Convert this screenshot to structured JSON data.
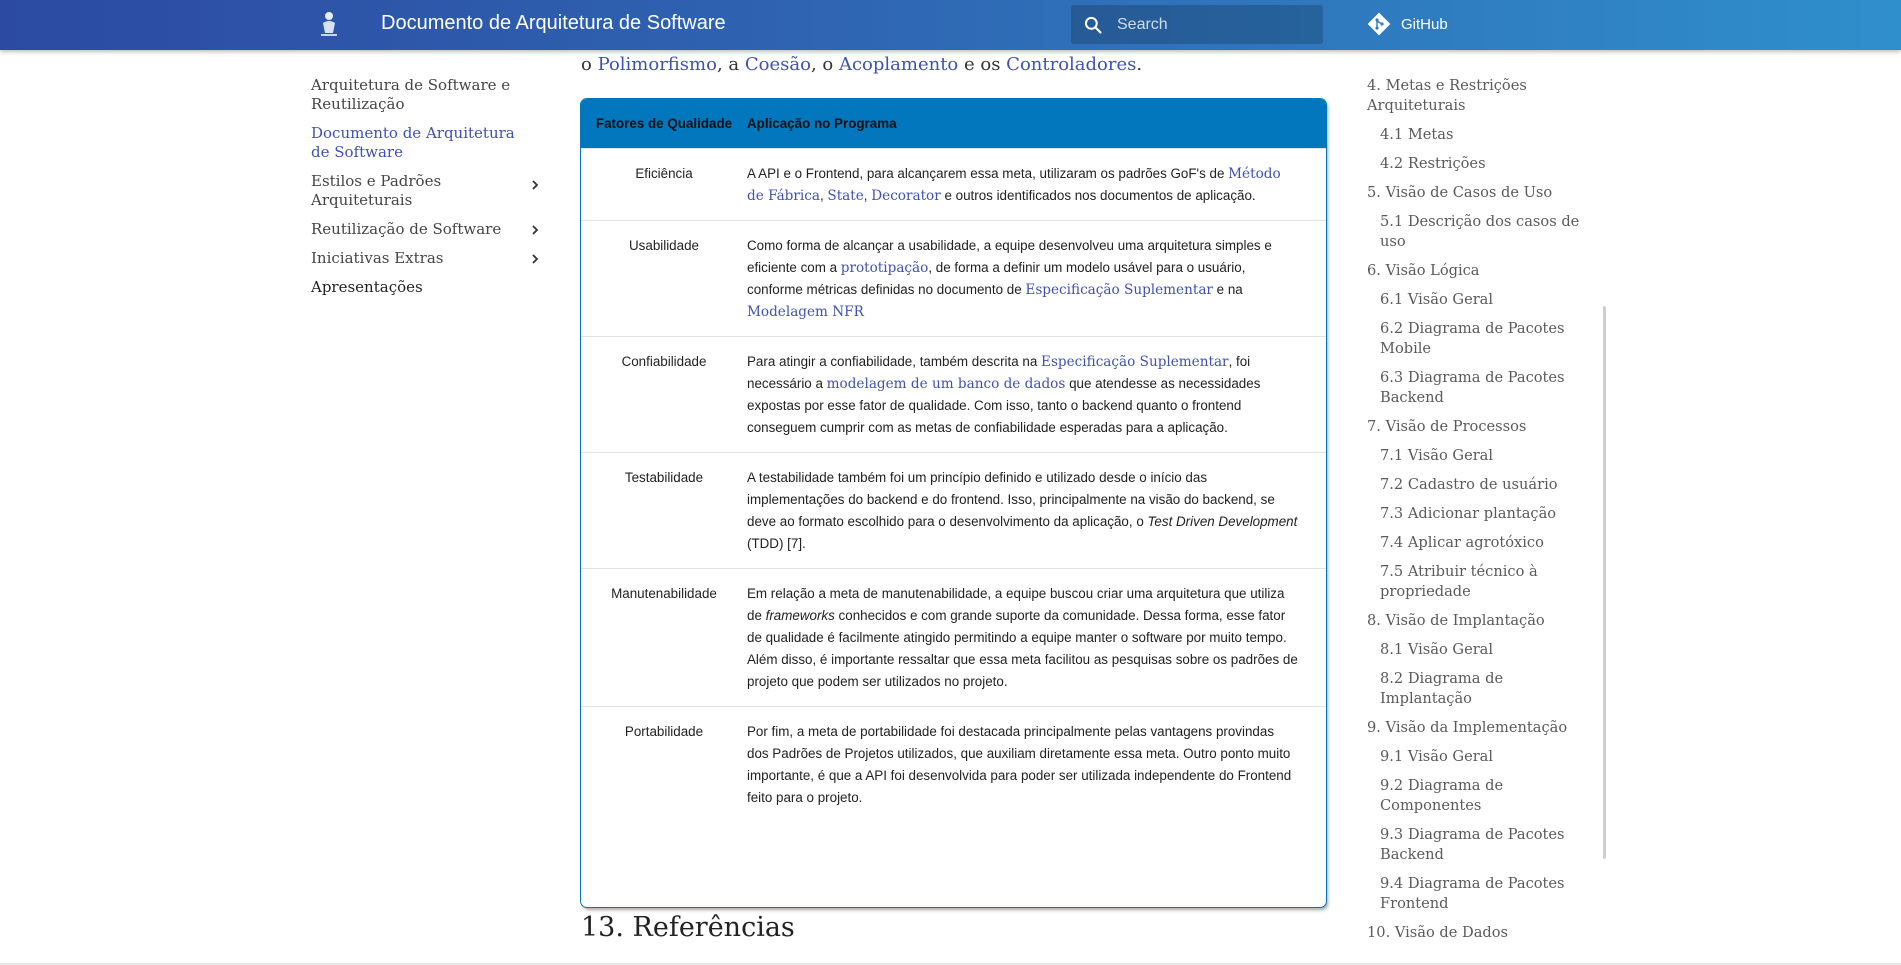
{
  "header": {
    "title": "Documento de Arquitetura de Software",
    "search_placeholder": "Search",
    "github_label": "GitHub"
  },
  "leftnav": {
    "items": [
      {
        "label": "Arquitetura de Software e Reutilização",
        "state": "normal"
      },
      {
        "label": "Documento de Arquitetura de Software",
        "state": "active"
      },
      {
        "label": "Estilos e Padrões Arquiteturais",
        "state": "expandable"
      },
      {
        "label": "Reutilização de Software",
        "state": "expandable"
      },
      {
        "label": "Iniciativas Extras",
        "state": "expandable"
      },
      {
        "label": "Apresentações",
        "state": "normal"
      }
    ]
  },
  "main": {
    "intro": {
      "prefix": "o ",
      "link1": "Polimorfismo",
      "sep1": ", a ",
      "link2": "Coesão",
      "sep2": ", o ",
      "link3": "Acoplamento",
      "sep3": " e os ",
      "link4": "Controladores",
      "suffix": "."
    },
    "table": {
      "headers": [
        "Fatores de Qualidade",
        "Aplicação no Programa"
      ],
      "rows": [
        {
          "factor": "Eficiência",
          "t1": "A API e o Frontend, para alcançarem essa meta, utilizaram os padrões GoF's de ",
          "l1": "Método de Fábrica",
          "t2": ", ",
          "l2": "State",
          "t3": ", ",
          "l3": "Decorator",
          "t4": " e outros identificados nos documentos de aplicação."
        },
        {
          "factor": "Usabilidade",
          "t1": "Como forma de alcançar a usabilidade, a equipe desenvolveu uma arquitetura simples e eficiente com a ",
          "l1": "prototipação",
          "t2": ", de forma a definir um modelo usável para o usuário, conforme métricas definidas no documento de ",
          "l2": "Especificação Suplementar",
          "t3": " e na ",
          "l3": "Modelagem NFR"
        },
        {
          "factor": "Confiabilidade",
          "t1": "Para atingir a confiabilidade, também descrita na ",
          "l1": "Especificação Suplementar",
          "t2": ", foi necessário a ",
          "l2": "modelagem de um banco de dados",
          "t3": " que atendesse as necessidades expostas por esse fator de qualidade. Com isso, tanto o backend quanto o frontend conseguem cumprir com as metas de confiabilidade esperadas para a aplicação."
        },
        {
          "factor": "Testabilidade",
          "t1": "A testabilidade também foi um princípio definido e utilizado desde o início das implementações do backend e do frontend. Isso, principalmente na visão do backend, se deve ao formato escolhido para o desenvolvimento da aplicação, o ",
          "em1": "Test Driven Development",
          "t2": " (TDD) [7]."
        },
        {
          "factor": "Manutenabilidade",
          "t1": "Em relação a meta de manutenabilidade, a equipe buscou criar uma arquitetura que utiliza de ",
          "em1": "frameworks",
          "t2": " conhecidos e com grande suporte da comunidade. Dessa forma, esse fator de qualidade é facilmente atingido permitindo a equipe manter o software por muito tempo. Além disso, é importante ressaltar que essa meta facilitou as pesquisas sobre os padrões de projeto que podem ser utilizados no projeto."
        },
        {
          "factor": "Portabilidade",
          "t1": "Por fim, a meta de portabilidade foi destacada principalmente pelas vantagens provindas dos Padrões de Projetos utilizados, que auxiliam diretamente essa meta. Outro ponto muito importante, é que a API foi desenvolvida para poder ser utilizada independente do Frontend feito para o projeto."
        }
      ]
    },
    "heading_13": "13. Referências"
  },
  "toc": {
    "items": [
      {
        "label": "4. Metas e Restrições Arquiteturais",
        "level": 1
      },
      {
        "label": "4.1 Metas",
        "level": 2
      },
      {
        "label": "4.2 Restrições",
        "level": 2
      },
      {
        "label": "5. Visão de Casos de Uso",
        "level": 1
      },
      {
        "label": "5.1 Descrição dos casos de uso",
        "level": 2
      },
      {
        "label": "6. Visão Lógica",
        "level": 1
      },
      {
        "label": "6.1 Visão Geral",
        "level": 2
      },
      {
        "label": "6.2 Diagrama de Pacotes Mobile",
        "level": 2
      },
      {
        "label": "6.3 Diagrama de Pacotes Backend",
        "level": 2
      },
      {
        "label": "7. Visão de Processos",
        "level": 1
      },
      {
        "label": "7.1 Visão Geral",
        "level": 2
      },
      {
        "label": "7.2 Cadastro de usuário",
        "level": 2
      },
      {
        "label": "7.3 Adicionar plantação",
        "level": 2
      },
      {
        "label": "7.4 Aplicar agrotóxico",
        "level": 2
      },
      {
        "label": "7.5 Atribuir técnico à propriedade",
        "level": 2
      },
      {
        "label": "8. Visão de Implantação",
        "level": 1
      },
      {
        "label": "8.1 Visão Geral",
        "level": 2
      },
      {
        "label": "8.2 Diagrama de Implantação",
        "level": 2
      },
      {
        "label": "9. Visão da Implementação",
        "level": 1
      },
      {
        "label": "9.1 Visão Geral",
        "level": 2
      },
      {
        "label": "9.2 Diagrama de Componentes",
        "level": 2
      },
      {
        "label": "9.3 Diagrama de Pacotes Backend",
        "level": 2
      },
      {
        "label": "9.4 Diagrama de Pacotes Frontend",
        "level": 2
      },
      {
        "label": "10. Visão de Dados",
        "level": 1
      }
    ]
  },
  "colors": {
    "header_start": "#2c4aa2",
    "header_end": "#2f8fcc",
    "table_header": "#0277bd",
    "link": "#3f51b5"
  }
}
